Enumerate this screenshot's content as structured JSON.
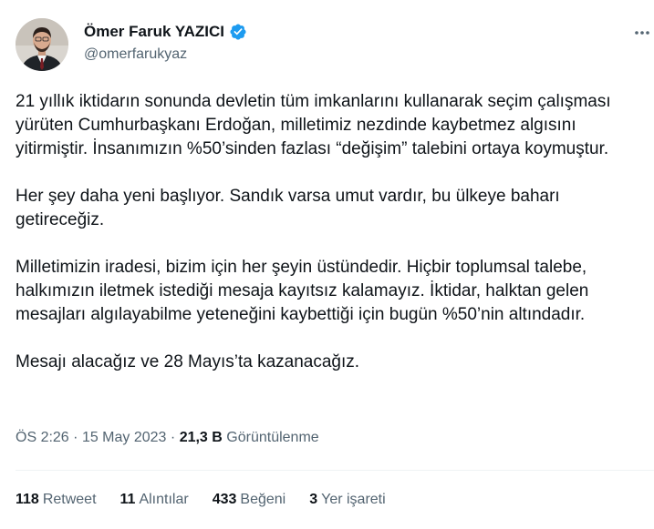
{
  "author": {
    "name": "Ömer Faruk YAZICI",
    "handle": "@omerfarukyaz",
    "verified": true,
    "verified_color": "#1d9bf0"
  },
  "tweet": {
    "paragraphs": [
      "21 yıllık iktidarın sonunda devletin tüm imkanlarını kullanarak seçim çalışması yürüten Cumhurbaşkanı Erdoğan, milletimiz nezdinde kaybetmez algısını yitirmiştir. İnsanımızın %50’sinden fazlası “değişim” talebini ortaya koymuştur.",
      "Her şey daha yeni başlıyor. Sandık varsa umut vardır, bu ülkeye baharı getireceğiz.",
      "Milletimizin iradesi, bizim için her şeyin üstündedir. Hiçbir toplumsal talebe, halkımızın iletmek istediği mesaja kayıtsız kalamayız. İktidar, halktan gelen mesajları algılayabilme yeteneğini kaybettiği için bugün %50’nin altındadır.",
      "Mesajı alacağız ve 28 Mayıs’ta kazanacağız."
    ]
  },
  "meta": {
    "time": "ÖS 2:26",
    "date": "15 May 2023",
    "separator": "·",
    "views_count": "21,3 B",
    "views_label": "Görüntülenme"
  },
  "stats": {
    "retweets_count": "118",
    "retweets_label": "Retweet",
    "quotes_count": "11",
    "quotes_label": "Alıntılar",
    "likes_count": "433",
    "likes_label": "Beğeni",
    "bookmarks_count": "3",
    "bookmarks_label": "Yer işareti"
  },
  "icons": {
    "more": "more-horizontal-icon",
    "verified": "verified-badge-icon"
  }
}
